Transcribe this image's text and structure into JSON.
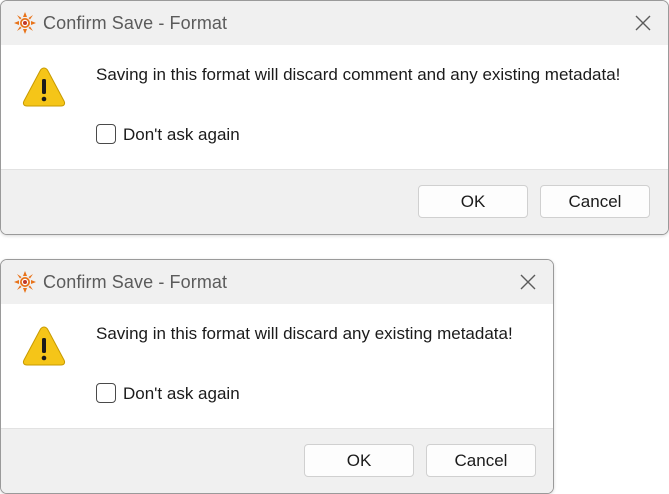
{
  "colors": {
    "titlebar_bg": "#f0f0f0",
    "footer_bg": "#f0f0f0",
    "warning_yellow": "#f5c518",
    "app_icon_orange": "#e8731a"
  },
  "dialogs": [
    {
      "title": "Confirm Save - Format",
      "message": "Saving in this format will discard comment and any existing metadata!",
      "checkbox_label": "Don't ask again",
      "checkbox_checked": false,
      "ok_label": "OK",
      "cancel_label": "Cancel",
      "icon": "warning-icon"
    },
    {
      "title": "Confirm Save - Format",
      "message": "Saving in this format will discard any existing metadata!",
      "checkbox_label": "Don't ask again",
      "checkbox_checked": false,
      "ok_label": "OK",
      "cancel_label": "Cancel",
      "icon": "warning-icon"
    }
  ]
}
